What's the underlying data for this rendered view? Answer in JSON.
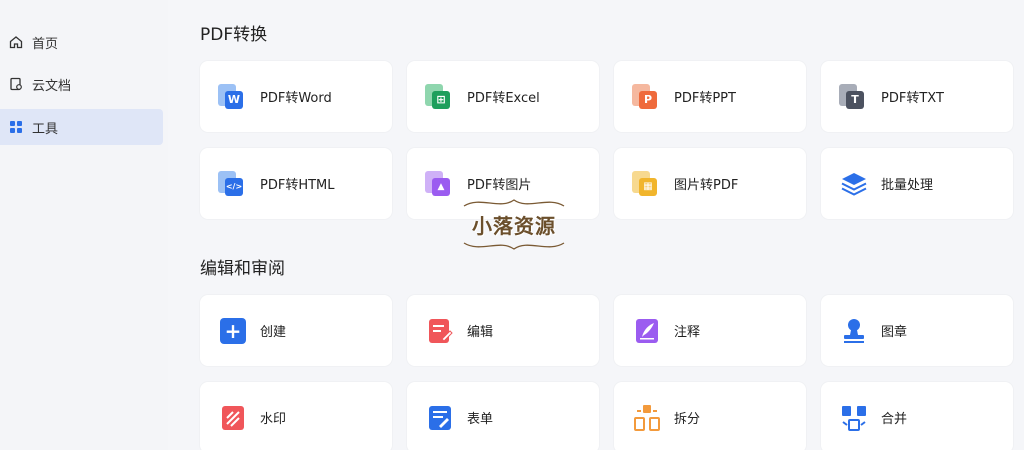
{
  "sidebar": {
    "items": [
      {
        "label": "首页",
        "icon": "home-icon",
        "active": false
      },
      {
        "label": "云文档",
        "icon": "cloud-doc-icon",
        "active": false
      },
      {
        "label": "工具",
        "icon": "grid-icon",
        "active": true
      }
    ]
  },
  "sections": {
    "convert": {
      "title": "PDF转换",
      "cards": [
        {
          "label": "PDF转Word",
          "icon": "word-icon",
          "glyph": "W",
          "color": "#2b6fe8",
          "back": "#9cc1f5"
        },
        {
          "label": "PDF转Excel",
          "icon": "excel-icon",
          "glyph": "⊞",
          "color": "#1e9f5c",
          "back": "#8fd6ae"
        },
        {
          "label": "PDF转PPT",
          "icon": "ppt-icon",
          "glyph": "P",
          "color": "#ef6a3c",
          "back": "#f5b89f"
        },
        {
          "label": "PDF转TXT",
          "icon": "txt-icon",
          "glyph": "T",
          "color": "#4c5260",
          "back": "#a8adb8"
        },
        {
          "label": "PDF转HTML",
          "icon": "html-icon",
          "glyph": "</>",
          "color": "#2b6fe8",
          "back": "#9cc1f5"
        },
        {
          "label": "PDF转图片",
          "icon": "image-icon",
          "glyph": "▲",
          "color": "#9b5cf0",
          "back": "#cfb1f7"
        },
        {
          "label": "图片转PDF",
          "icon": "image-to-pdf-icon",
          "glyph": "▦",
          "color": "#f1b52c",
          "back": "#f7d98f"
        },
        {
          "label": "批量处理",
          "icon": "layers-icon",
          "glyph": "≋",
          "color": "#2b6fe8",
          "back": ""
        }
      ]
    },
    "edit": {
      "title": "编辑和审阅",
      "cards": [
        {
          "label": "创建",
          "icon": "plus-icon",
          "glyph": "+",
          "color": "#2b6fe8"
        },
        {
          "label": "编辑",
          "icon": "edit-icon",
          "glyph": "≡",
          "color": "#f0565a"
        },
        {
          "label": "注释",
          "icon": "annotate-icon",
          "glyph": "✎",
          "color": "#9b5cf0"
        },
        {
          "label": "图章",
          "icon": "stamp-icon",
          "glyph": "●",
          "color": "#2b6fe8"
        },
        {
          "label": "水印",
          "icon": "watermark-icon",
          "glyph": "⫽",
          "color": "#f0565a"
        },
        {
          "label": "表单",
          "icon": "form-icon",
          "glyph": "≡",
          "color": "#2b6fe8"
        },
        {
          "label": "拆分",
          "icon": "split-icon",
          "glyph": "⊞",
          "color": "#f39a3c"
        },
        {
          "label": "合并",
          "icon": "merge-icon",
          "glyph": "⊞",
          "color": "#2b6fe8"
        }
      ]
    }
  },
  "watermark": {
    "text": "小落资源"
  }
}
